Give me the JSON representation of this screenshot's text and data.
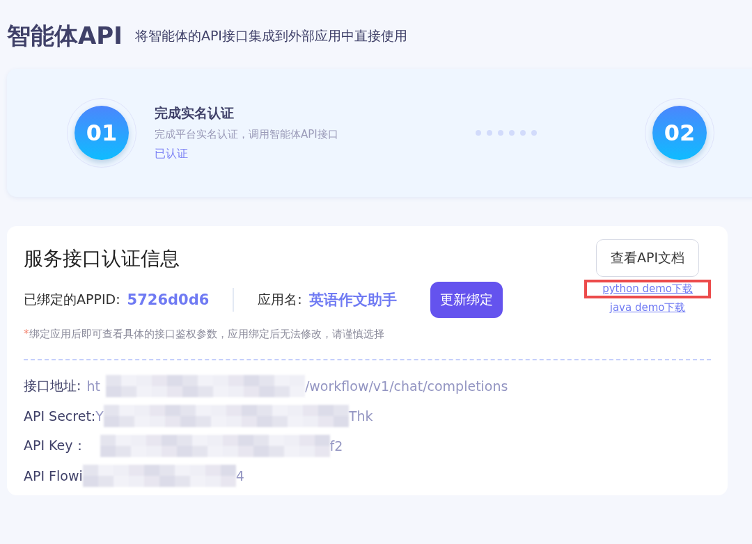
{
  "header": {
    "title": "智能体API",
    "subtitle": "将智能体的API接口集成到外部应用中直接使用"
  },
  "steps": [
    {
      "number": "01",
      "title": "完成实名认证",
      "description": "完成平台实名认证，调用智能体API接口",
      "status": "已认证"
    },
    {
      "number": "02"
    }
  ],
  "service": {
    "title": "服务接口认证信息",
    "appid_label": "已绑定的APPID:",
    "appid": "5726d0d6",
    "app_name_label": "应用名:",
    "app_name": "英语作文助手",
    "rebind_button": "更新绑定",
    "docs_button": "查看API文档",
    "links": [
      {
        "label": "python demo下载",
        "highlighted": true
      },
      {
        "label": "java demo下载",
        "highlighted": false
      }
    ],
    "note_mark": "*",
    "note": "绑定应用后即可查看具体的接口鉴权参数，应用绑定后无法修改，请谨慎选择",
    "fields": [
      {
        "label": "接口地址:",
        "prefix": "ht",
        "suffix": "/workflow/v1/chat/completions"
      },
      {
        "label": "API Secret:",
        "prefix": "Y",
        "suffix": "Thk"
      },
      {
        "label": "API Key：",
        "suffix": "f2"
      },
      {
        "label": "API Flowi",
        "suffix": "4"
      }
    ]
  }
}
